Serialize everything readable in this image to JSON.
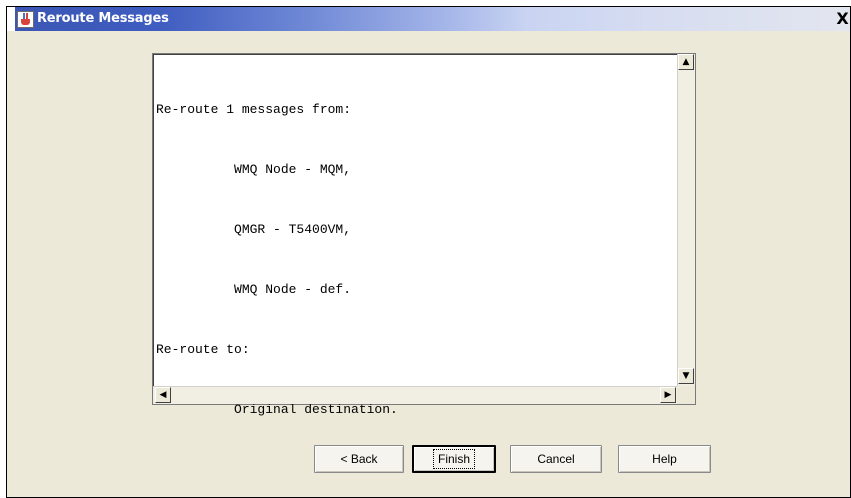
{
  "window": {
    "title": "Reroute Messages",
    "close_glyph": "X",
    "icon": "java-cup-icon"
  },
  "summary": {
    "lines": [
      "Re-route 1 messages from:",
      "          WMQ Node - MQM,",
      "          QMGR - T5400VM,",
      "          WMQ Node - def.",
      "Re-route to:",
      "          Original destination."
    ]
  },
  "buttons": {
    "back": "< Back",
    "finish": "Finish",
    "cancel": "Cancel",
    "help": "Help"
  },
  "colors": {
    "titlebar_start": "#3b56b4",
    "titlebar_end": "#e3e6ef",
    "dialog_bg": "#ece9d8"
  }
}
